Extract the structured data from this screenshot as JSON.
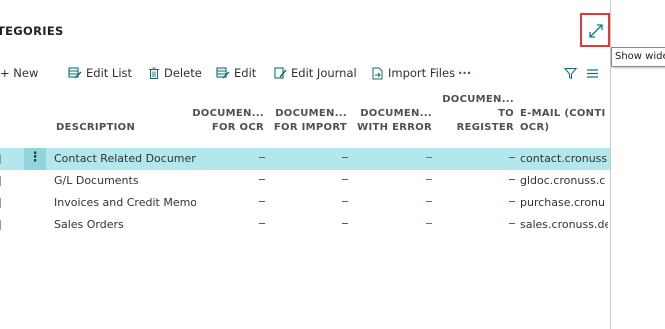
{
  "page": {
    "title": "TEGORIES",
    "show_wide_tooltip": "Show wide"
  },
  "toolbar": {
    "new_label": "+ New",
    "edit_list_label": "Edit List",
    "delete_label": "Delete",
    "edit_label": "Edit",
    "edit_journal_label": "Edit Journal",
    "import_files_label": "Import Files",
    "more_label": "···"
  },
  "columns": {
    "description": "DESCRIPTION",
    "for_ocr_line1": "DOCUMEN...",
    "for_ocr_line2": "FOR OCR",
    "for_import_line1": "DOCUMEN...",
    "for_import_line2": "FOR IMPORT",
    "with_error_line1": "DOCUMEN...",
    "with_error_line2": "WITH ERROR",
    "to_register_line1": "DOCUMEN...",
    "to_register_line2": "TO",
    "to_register_line3": "REGISTER",
    "email_line1": "E-MAIL (CONTI",
    "email_line2": "OCR)"
  },
  "rows": [
    {
      "description": "Contact Related Documents",
      "email": "contact.cronuss"
    },
    {
      "description": "G/L Documents",
      "email": "gldoc.cronuss.c"
    },
    {
      "description": "Invoices and Credit Memos",
      "email": "purchase.cronu"
    },
    {
      "description": "Sales Orders",
      "email": "sales.cronuss.de"
    }
  ],
  "row_menu_glyph": "⋮",
  "colors": {
    "accent": "#008489",
    "error": "#e0403d",
    "selected_row": "#b2e8ec",
    "highlight_border": "#e03b3b"
  },
  "icons": {
    "show_wide": "expand-diagonal-icon",
    "edit_list": "edit-list-icon",
    "delete": "trash-icon",
    "edit": "edit-icon",
    "edit_journal": "edit-journal-icon",
    "import_files": "import-file-icon",
    "filter": "filter-icon",
    "list_view": "list-view-icon"
  }
}
